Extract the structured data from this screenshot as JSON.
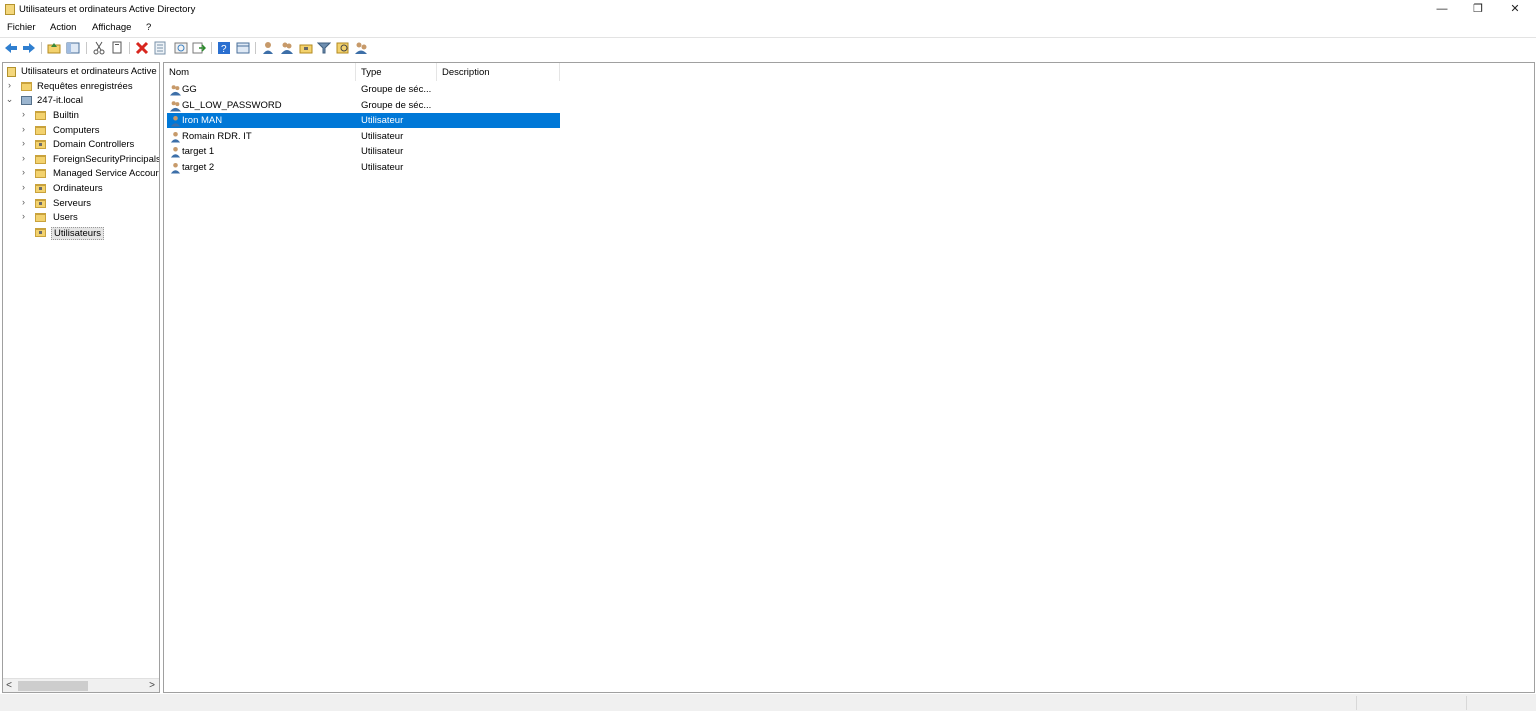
{
  "window": {
    "title": "Utilisateurs et ordinateurs Active Directory",
    "controls": {
      "minimize": "—",
      "restore": "❐",
      "close": "✕"
    }
  },
  "menu": [
    "Fichier",
    "Action",
    "Affichage",
    "?"
  ],
  "toolbar": {
    "icons": [
      "back-icon",
      "forward-icon",
      "up-folder-icon",
      "show-console-tree-icon",
      "cut-icon",
      "copy-icon",
      "delete-icon",
      "properties-icon",
      "refresh-icon",
      "export-list-icon",
      "help-icon",
      "view-icon",
      "new-user-icon",
      "new-group-icon",
      "new-ou-icon",
      "filter-icon",
      "find-icon",
      "delegate-icon"
    ]
  },
  "tree": {
    "root": "Utilisateurs et ordinateurs Active",
    "saved_queries": "Requêtes enregistrées",
    "domain": "247-it.local",
    "children": [
      "Builtin",
      "Computers",
      "Domain Controllers",
      "ForeignSecurityPrincipals",
      "Managed Service Accour",
      "Ordinateurs",
      "Serveurs",
      "Users",
      "Utilisateurs"
    ],
    "selected": "Utilisateurs",
    "scroll_left": "<",
    "scroll_right": ">"
  },
  "list": {
    "columns": [
      "Nom",
      "Type",
      "Description"
    ],
    "rows": [
      {
        "name": "GG",
        "type": "Groupe de séc...",
        "description": "",
        "kind": "group"
      },
      {
        "name": "GL_LOW_PASSWORD",
        "type": "Groupe de séc...",
        "description": "",
        "kind": "group"
      },
      {
        "name": "Iron MAN",
        "type": "Utilisateur",
        "description": "",
        "kind": "user",
        "selected": true
      },
      {
        "name": "Romain RDR. IT",
        "type": "Utilisateur",
        "description": "",
        "kind": "user"
      },
      {
        "name": "target 1",
        "type": "Utilisateur",
        "description": "",
        "kind": "user"
      },
      {
        "name": "target 2",
        "type": "Utilisateur",
        "description": "",
        "kind": "user"
      }
    ]
  },
  "colors": {
    "selection": "#0078d7",
    "folder": "#f3d26e"
  }
}
